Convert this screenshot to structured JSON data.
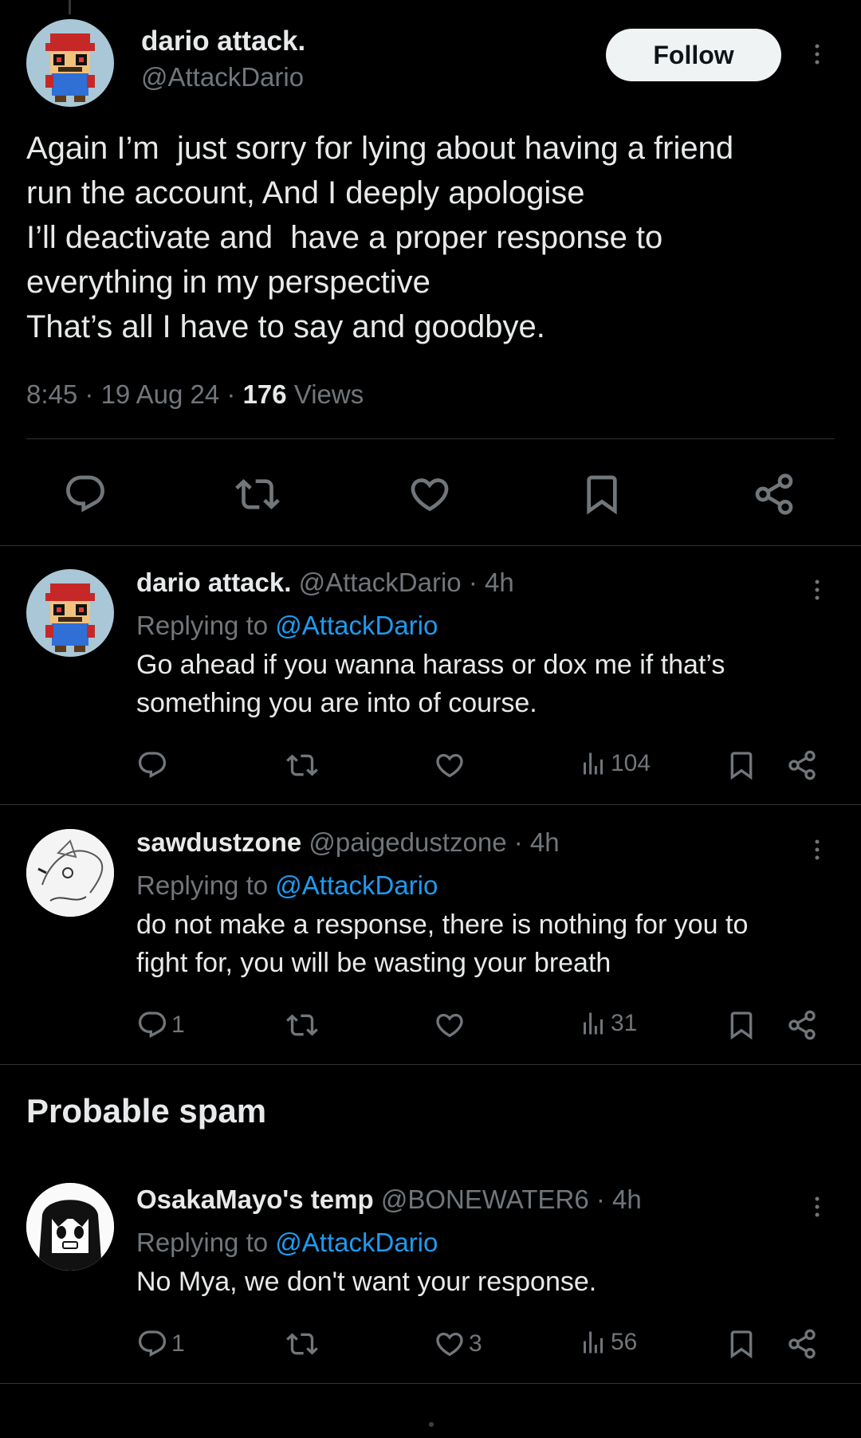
{
  "main_tweet": {
    "name": "dario attack.",
    "handle": "@AttackDario",
    "follow_label": "Follow",
    "text_lines": [
      "Again I’m  just sorry for lying about having a friend",
      "run the account, And I deeply apologise",
      "I’ll deactivate and  have a proper response to",
      "everything in my perspective",
      "That’s all I have to say and goodbye."
    ],
    "time": "8:45",
    "date": "19 Aug 24",
    "views_count": "176",
    "views_label": "Views"
  },
  "replies": [
    {
      "name": "dario attack.",
      "handle": "@AttackDario",
      "age": "· 4h",
      "replying_prefix": "Replying to",
      "replying_to": "@AttackDario",
      "text_lines": [
        "Go ahead if you wanna harass or dox me if that’s",
        "something you are into of course."
      ],
      "replies": "",
      "likes": "",
      "views": "104"
    },
    {
      "name": "sawdustzone",
      "handle": "@paigedustzone",
      "age": "· 4h",
      "replying_prefix": "Replying to",
      "replying_to": "@AttackDario",
      "text_lines": [
        "do not make a response, there is nothing for you to",
        "fight for, you will be wasting your breath"
      ],
      "replies": "1",
      "likes": "",
      "views": "31"
    },
    {
      "name": "OsakaMayo's temp",
      "handle": "@BONEWATER6",
      "age": "· 4h",
      "replying_prefix": "Replying to",
      "replying_to": "@AttackDario",
      "text_lines": [
        "No Mya, we don't want your response."
      ],
      "replies": "1",
      "likes": "3",
      "views": "56"
    }
  ],
  "section": {
    "spam_title": "Probable spam"
  },
  "icons": {
    "reply": "reply-icon",
    "retweet": "retweet-icon",
    "like": "heart-icon",
    "bookmark": "bookmark-icon",
    "share": "share-icon",
    "views": "views-icon",
    "more": "more-icon"
  },
  "colors": {
    "background": "#000000",
    "text": "#e7e9ea",
    "muted": "#71767b",
    "link": "#1d9bf0",
    "follow_bg": "#eff3f4"
  }
}
